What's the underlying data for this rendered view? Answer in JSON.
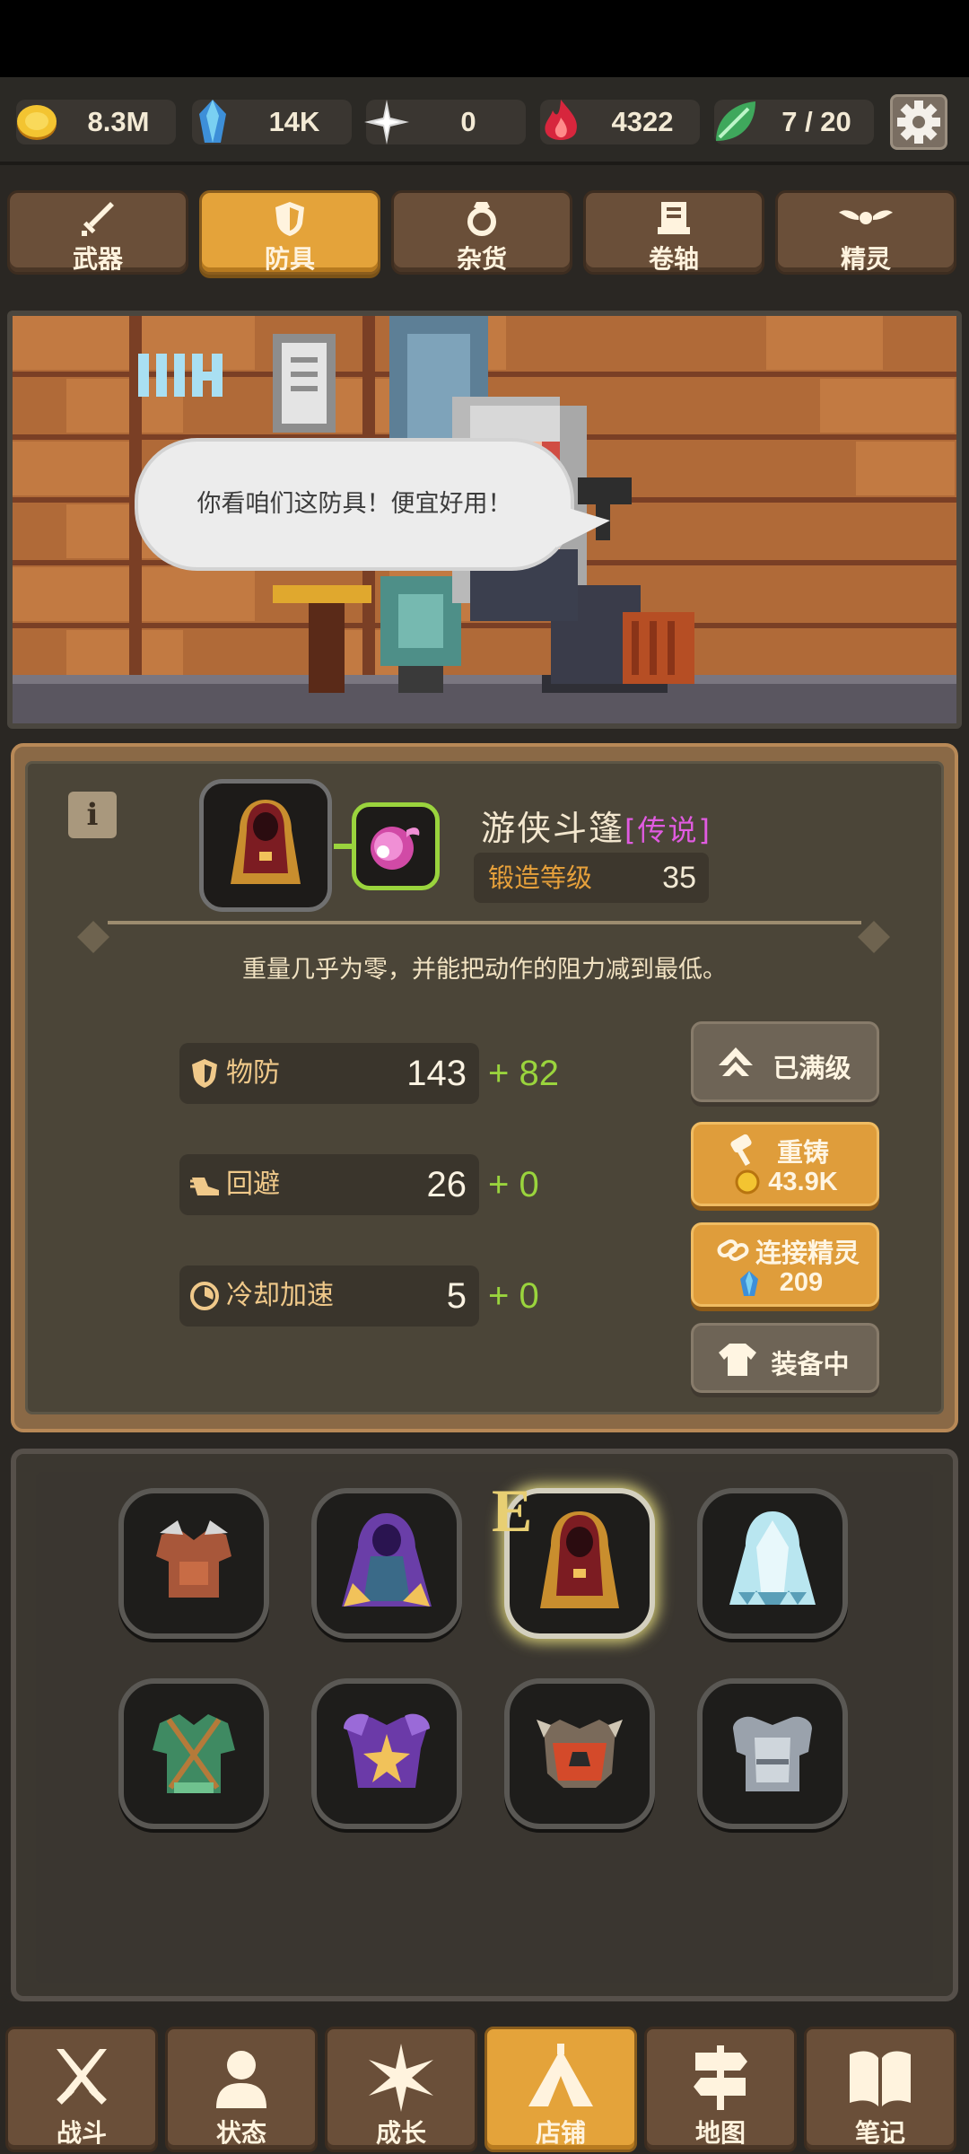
{
  "resources": [
    {
      "name": "gold",
      "value": "8.3M",
      "icon": "gold-coin-icon"
    },
    {
      "name": "gem",
      "value": "14K",
      "icon": "blue-crystal-icon"
    },
    {
      "name": "star",
      "value": "0",
      "icon": "sparkle-icon"
    },
    {
      "name": "flame",
      "value": "4322",
      "icon": "red-flame-icon"
    },
    {
      "name": "spirit",
      "value": "7 / 20",
      "icon": "green-leaf-icon"
    }
  ],
  "tabs": [
    {
      "label": "武器",
      "icon": "sword-icon"
    },
    {
      "label": "防具",
      "icon": "shield-icon",
      "active": true
    },
    {
      "label": "杂货",
      "icon": "ring-icon"
    },
    {
      "label": "卷轴",
      "icon": "scroll-icon"
    },
    {
      "label": "精灵",
      "icon": "wings-icon"
    }
  ],
  "scene": {
    "dialog": "你看咱们这防具！便宜好用！"
  },
  "item": {
    "name": "游侠斗篷",
    "rarity": "[传说]",
    "forge_label": "锻造等级",
    "forge_level": "35",
    "description": "重量几乎为零，并能把动作的阻力减到最低。"
  },
  "stats": [
    {
      "label": "物防",
      "value": "143",
      "bonus": "+ 82",
      "icon": "shield-small-icon"
    },
    {
      "label": "回避",
      "value": "26",
      "bonus": "+ 0",
      "icon": "winged-boot-icon"
    },
    {
      "label": "冷却加速",
      "value": "5",
      "bonus": "+ 0",
      "icon": "cooldown-icon"
    }
  ],
  "actions": {
    "maxed_label": "已满级",
    "reforge_label": "重铸",
    "reforge_cost": "43.9K",
    "link_label": "连接精灵",
    "link_cost": "209",
    "equipped_label": "装备中"
  },
  "inventory": {
    "equipped_marker": "E",
    "items": [
      {
        "name": "leather-vest"
      },
      {
        "name": "purple-mage-robe"
      },
      {
        "name": "ranger-cloak",
        "equipped": true
      },
      {
        "name": "ice-robe"
      },
      {
        "name": "green-tunic"
      },
      {
        "name": "purple-star-armor"
      },
      {
        "name": "spiked-orange-armor"
      },
      {
        "name": "steel-plate-armor"
      }
    ]
  },
  "nav": [
    {
      "label": "战斗",
      "icon": "crossed-swords-icon"
    },
    {
      "label": "状态",
      "icon": "person-icon"
    },
    {
      "label": "成长",
      "icon": "star-burst-icon"
    },
    {
      "label": "店铺",
      "icon": "tent-icon",
      "active": true
    },
    {
      "label": "地图",
      "icon": "signpost-icon"
    },
    {
      "label": "笔记",
      "icon": "open-book-icon"
    }
  ],
  "colors": {
    "accent_orange": "#e4a33a",
    "tab_brown": "#6a4f39",
    "bonus_green": "#9ad43d",
    "rarity_legendary": "#e05be0",
    "forge_orange": "#e6a03b"
  }
}
